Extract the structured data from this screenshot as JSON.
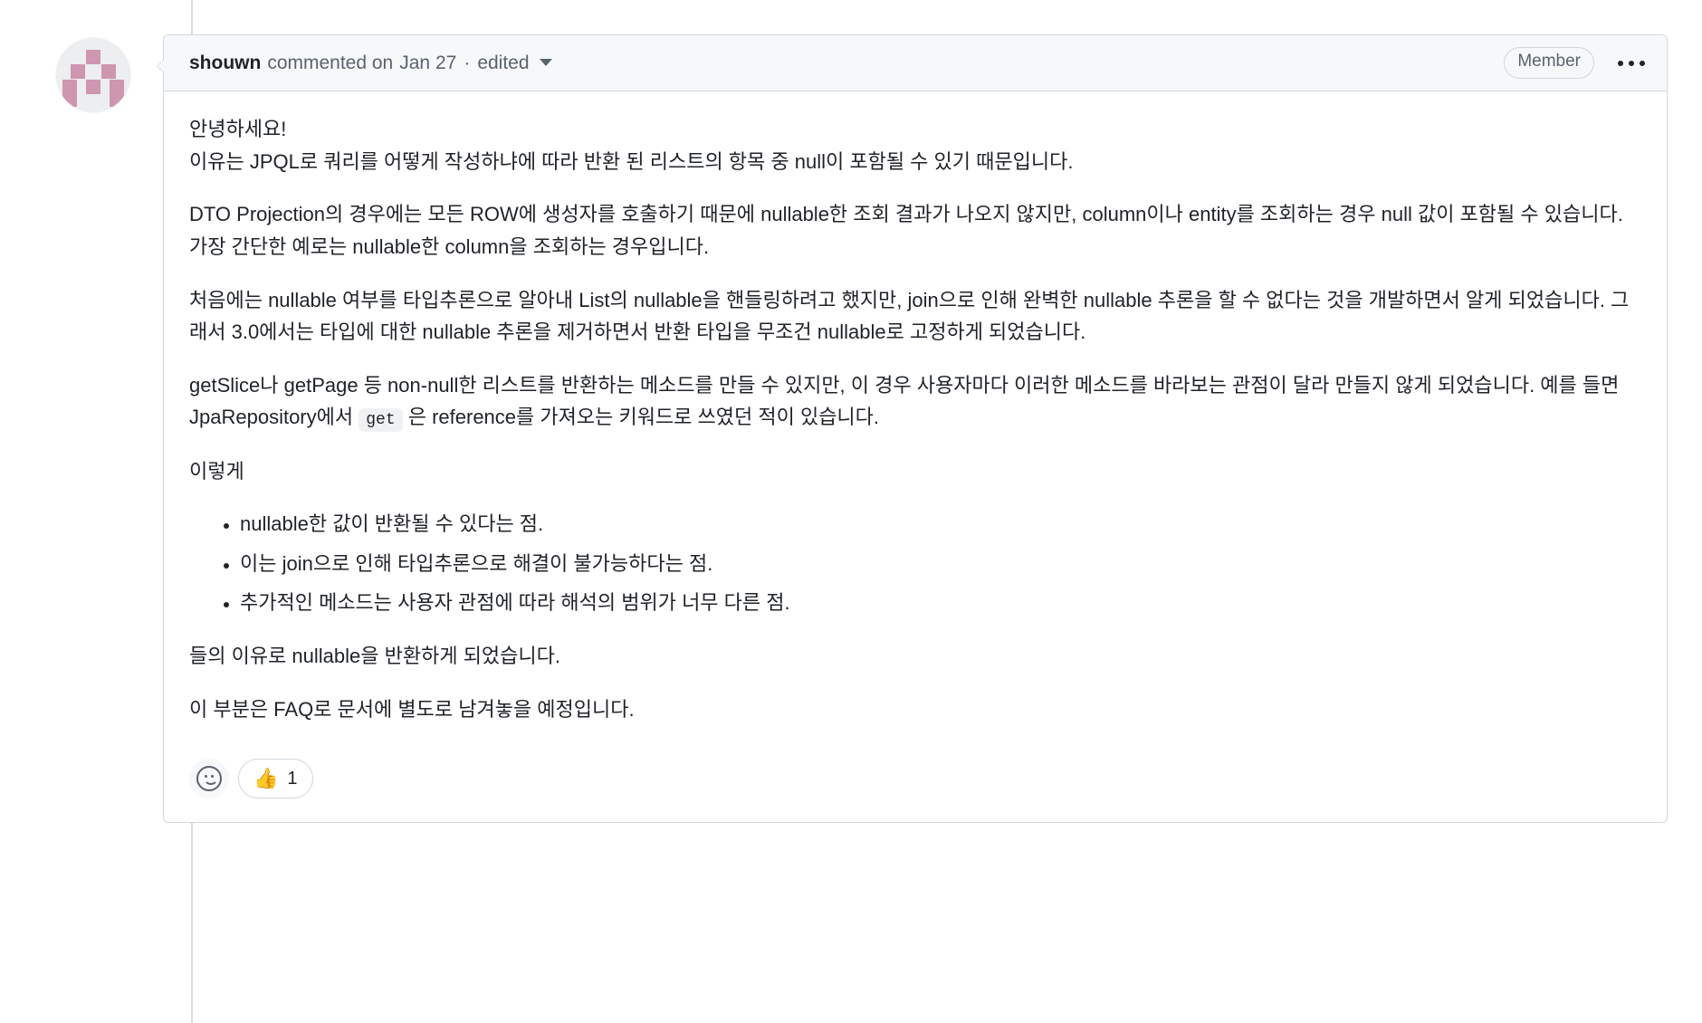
{
  "comment": {
    "author": "shouwn",
    "action": "commented on",
    "date": "Jan 27",
    "separator": "·",
    "edited_label": "edited",
    "role_badge": "Member",
    "menu_icon": "kebab-horizontal-icon",
    "avatar_alt": "shouwn identicon avatar",
    "body": {
      "p1_line1": "안녕하세요!",
      "p1_line2": "이유는 JPQL로 쿼리를 어떻게 작성하냐에 따라 반환 된 리스트의 항목 중 null이 포함될 수 있기 때문입니다.",
      "p2": "DTO Projection의 경우에는 모든 ROW에 생성자를 호출하기 때문에 nullable한 조회 결과가 나오지 않지만, column이나 entity를 조회하는 경우 null 값이 포함될 수 있습니다. 가장 간단한 예로는 nullable한 column을 조회하는 경우입니다.",
      "p3": "처음에는 nullable 여부를 타입추론으로 알아내 List의 nullable을 핸들링하려고 했지만, join으로 인해 완벽한 nullable 추론을 할 수 없다는 것을 개발하면서 알게 되었습니다. 그래서 3.0에서는 타입에 대한 nullable 추론을 제거하면서 반환 타입을 무조건 nullable로 고정하게 되었습니다.",
      "p4_before_code": "getSlice나 getPage 등 non-null한 리스트를 반환하는 메소드를 만들 수 있지만, 이 경우 사용자마다 이러한 메소드를 바라보는 관점이 달라 만들지 않게 되었습니다. 예를 들면 JpaRepository에서 ",
      "p4_code": "get",
      "p4_after_code": " 은 reference를 가져오는 키워드로 쓰였던 적이 있습니다.",
      "p5": "이렇게",
      "bullets": [
        "nullable한 값이 반환될 수 있다는 점.",
        "이는 join으로 인해 타입추론으로 해결이 불가능하다는 점.",
        "추가적인 메소드는 사용자 관점에 따라 해석의 범위가 너무 다른 점."
      ],
      "p6": "들의 이유로 nullable을 반환하게 되었습니다.",
      "p7": "이 부분은 FAQ로 문서에 별도로 남겨놓을 예정입니다."
    },
    "reactions": {
      "add_icon": "smiley-add-icon",
      "items": [
        {
          "emoji": "👍",
          "name": "thumbs-up",
          "count": "1"
        }
      ]
    }
  },
  "colors": {
    "header_bg": "#f6f8fa",
    "border": "#d0d7de",
    "text": "#1F2328",
    "muted_text": "#59636e",
    "code_bg": "#eff1f3",
    "rail": "#d8dee4",
    "avatar_block": "#cf96b0"
  }
}
